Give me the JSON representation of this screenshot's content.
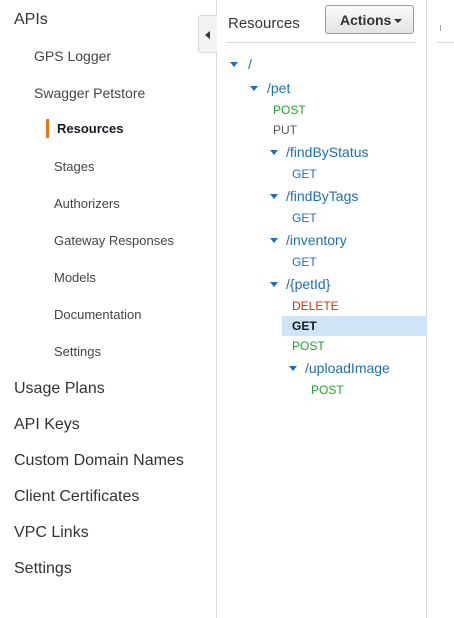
{
  "left_nav": {
    "apis_label": "APIs",
    "apis": [
      {
        "label": "GPS Logger"
      },
      {
        "label": "Swagger Petstore"
      }
    ],
    "api_sections": [
      {
        "label": "Resources",
        "active": true
      },
      {
        "label": "Stages"
      },
      {
        "label": "Authorizers"
      },
      {
        "label": "Gateway Responses"
      },
      {
        "label": "Models"
      },
      {
        "label": "Documentation"
      },
      {
        "label": "Settings"
      }
    ],
    "bottom": [
      {
        "label": "Usage Plans"
      },
      {
        "label": "API Keys"
      },
      {
        "label": "Custom Domain Names"
      },
      {
        "label": "Client Certificates"
      },
      {
        "label": "VPC Links"
      },
      {
        "label": "Settings"
      }
    ],
    "active_color": "#ec7211"
  },
  "resources": {
    "title": "Resources",
    "actions_label": "Actions",
    "tree": [
      {
        "path": "/",
        "children": [
          {
            "path": "/pet",
            "methods": [
              "POST",
              "PUT"
            ],
            "children": [
              {
                "path": "/findByStatus",
                "methods": [
                  "GET"
                ]
              },
              {
                "path": "/findByTags",
                "methods": [
                  "GET"
                ]
              },
              {
                "path": "/inventory",
                "methods": [
                  "GET"
                ]
              },
              {
                "path": "/{petId}",
                "methods": [
                  "DELETE",
                  "GET",
                  "POST"
                ],
                "selected_method": "GET",
                "children": [
                  {
                    "path": "/uploadImage",
                    "methods": [
                      "POST"
                    ]
                  }
                ]
              }
            ]
          }
        ]
      }
    ]
  },
  "colors": {
    "link": "#1f6fb2",
    "post": "#1ea52b",
    "delete": "#d13212",
    "selected_bg": "#cfe4f6"
  }
}
